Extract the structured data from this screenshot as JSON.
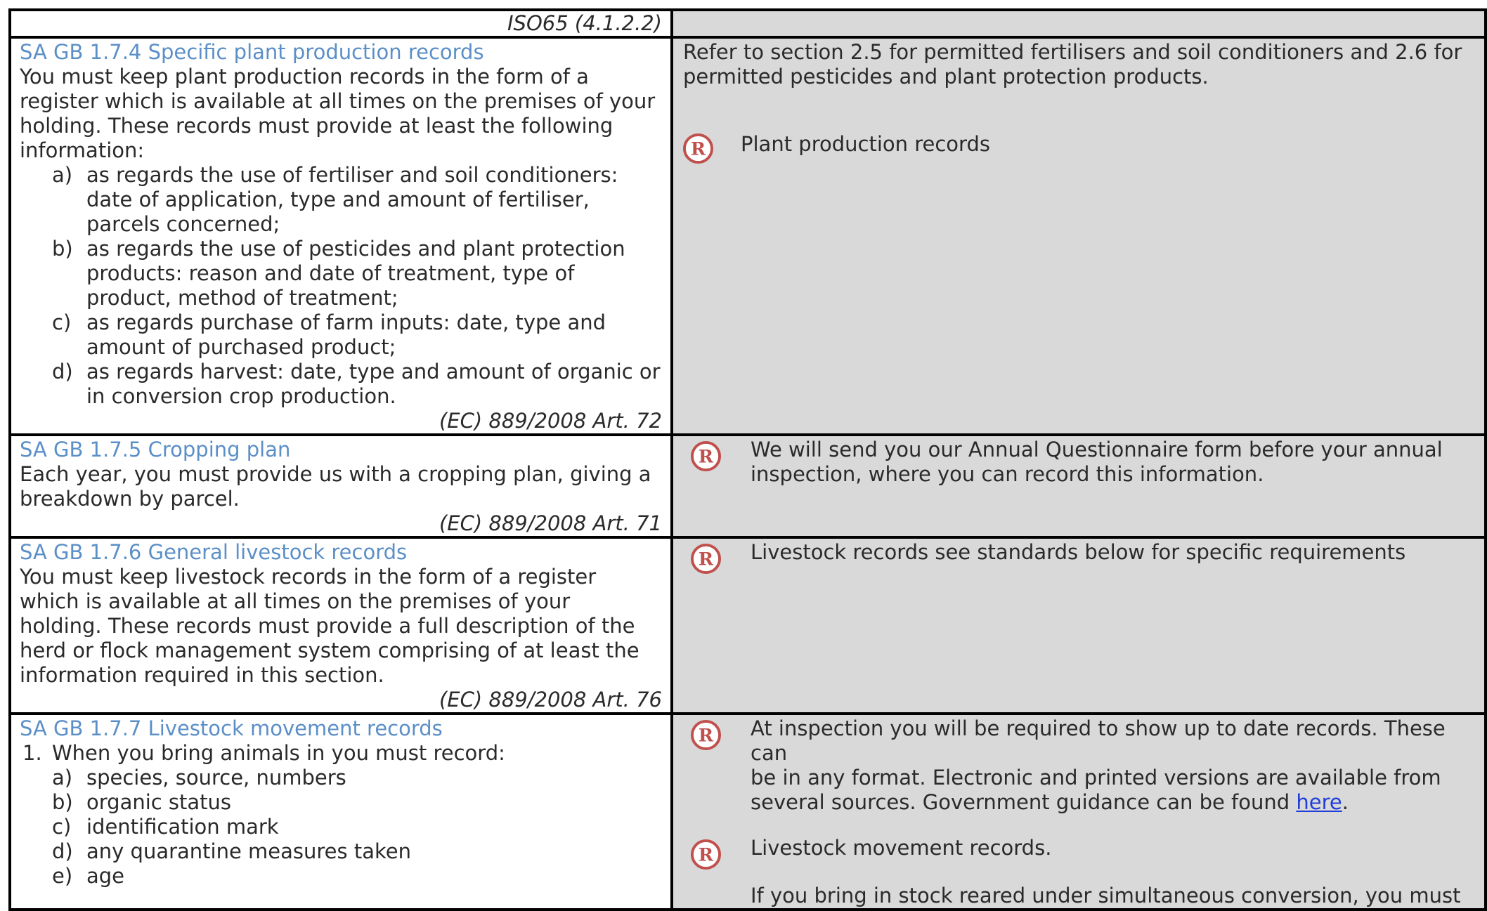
{
  "header_ref": "ISO65 (4.1.2.2)",
  "record_icon": "registered-circle-icon",
  "sections": {
    "s174": {
      "title": "SA GB 1.7.4 Specific plant production records",
      "intro": [
        "You must keep plant production records in the form of a",
        "register which is available at all times on the premises of your",
        "holding. These records must provide at least the following",
        "information:"
      ],
      "items": [
        {
          "marker": "a)",
          "lines": [
            "as regards the use of fertiliser and soil conditioners:",
            "date of application, type and amount of fertiliser,",
            "parcels concerned;"
          ]
        },
        {
          "marker": "b)",
          "lines": [
            "as regards the use of pesticides and plant protection",
            "products: reason and date of treatment, type of",
            "product, method of treatment;"
          ]
        },
        {
          "marker": "c)",
          "lines": [
            "as regards purchase of farm inputs: date, type and",
            "amount of purchased product;"
          ]
        },
        {
          "marker": "d)",
          "lines": [
            "as regards harvest: date, type and amount of organic or",
            "in conversion crop production."
          ]
        }
      ],
      "ref": "(EC) 889/2008 Art. 72",
      "guidance": [
        "Refer to section 2.5 for permitted fertilisers and soil conditioners and 2.6 for",
        "permitted pesticides and plant protection products."
      ],
      "record_label": "Plant production records"
    },
    "s175": {
      "title": "SA GB 1.7.5 Cropping plan",
      "body": [
        "Each year, you must provide us with a cropping plan, giving a",
        "breakdown by parcel."
      ],
      "ref": "(EC) 889/2008 Art. 71",
      "guidance": [
        "We will send you our Annual Questionnaire form before your annual",
        "inspection, where you can record this information."
      ]
    },
    "s176": {
      "title": "SA GB 1.7.6 General livestock records",
      "body": [
        "You must keep livestock records in the form of a register",
        "which is available at all times on the premises of your",
        "holding. These records must provide a full description of the",
        "herd or flock management system comprising of at least the",
        "information required in this section."
      ],
      "ref": "(EC) 889/2008 Art. 76",
      "guidance": "Livestock records see standards below for specific requirements"
    },
    "s177": {
      "title": "SA GB 1.7.7 Livestock movement records",
      "item1_marker": "1.",
      "item1_text": "When you bring animals in you must record:",
      "subitems": [
        {
          "marker": "a)",
          "text": "species, source, numbers"
        },
        {
          "marker": "b)",
          "text": "organic status"
        },
        {
          "marker": "c)",
          "text": "identification mark"
        },
        {
          "marker": "d)",
          "text": "any quarantine measures taken"
        },
        {
          "marker": "e)",
          "text": "age"
        }
      ],
      "guidance_lines": [
        "At inspection you will be required to show up to date records. These can",
        "be in any format. Electronic and printed versions are available from"
      ],
      "guidance_last": "several sources. Government guidance can be found ",
      "link_text": "here",
      "link_after": ".",
      "record_label": "Livestock movement records.",
      "conversion_note": "If you bring in stock reared under simultaneous conversion, you must"
    }
  }
}
